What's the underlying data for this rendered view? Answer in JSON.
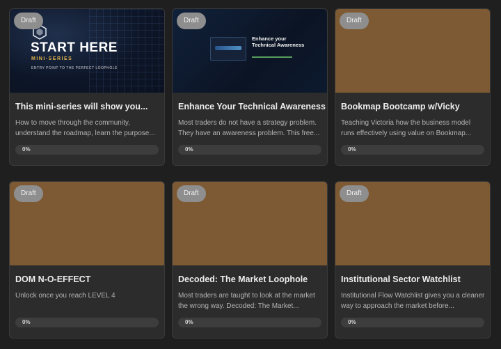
{
  "courses": [
    {
      "badge": "Draft",
      "thumb": {
        "style": "navy",
        "logo": "hexagon-logo",
        "headline": "START HERE",
        "subhead": "MINI-SERIES",
        "tagline": "ENTRY POINT TO THE PERFECT LOOPHOLE"
      },
      "title": "This mini-series will show you...",
      "description": "How to move through the community, understand the roadmap, learn the purpose...",
      "progress": 0,
      "progress_label": "0%"
    },
    {
      "badge": "Draft",
      "thumb": {
        "style": "dark2",
        "headline": "Enhance your Technical Awareness"
      },
      "title": "Enhance Your Technical Awareness",
      "description": "Most traders do not have a strategy problem. They have an awareness problem. This free...",
      "progress": 0,
      "progress_label": "0%"
    },
    {
      "badge": "Draft",
      "thumb": {
        "style": "brown"
      },
      "title": "Bookmap Bootcamp w/Vicky",
      "description": "Teaching Victoria how the business model runs effectively using value on Bookmap...",
      "progress": 0,
      "progress_label": "0%"
    },
    {
      "badge": "Draft",
      "thumb": {
        "style": "brown"
      },
      "title": "DOM N-O-EFFECT",
      "description": "Unlock once you reach LEVEL 4",
      "progress": 0,
      "progress_label": "0%"
    },
    {
      "badge": "Draft",
      "thumb": {
        "style": "brown"
      },
      "title": "Decoded: The Market Loophole",
      "description": "Most traders are taught to look at the market the wrong way. Decoded: The Market...",
      "progress": 0,
      "progress_label": "0%"
    },
    {
      "badge": "Draft",
      "thumb": {
        "style": "brown"
      },
      "title": "Institutional Sector Watchlist",
      "description": "Institutional Flow Watchlist gives you a cleaner way to approach the market before...",
      "progress": 0,
      "progress_label": "0%"
    }
  ],
  "colors": {
    "page_bg": "#1f1f1f",
    "card_bg": "#2c2c2c",
    "thumb_brown": "#7d5a33",
    "badge_bg": "#8e8e8e",
    "accent_gold": "#e0b34a"
  }
}
